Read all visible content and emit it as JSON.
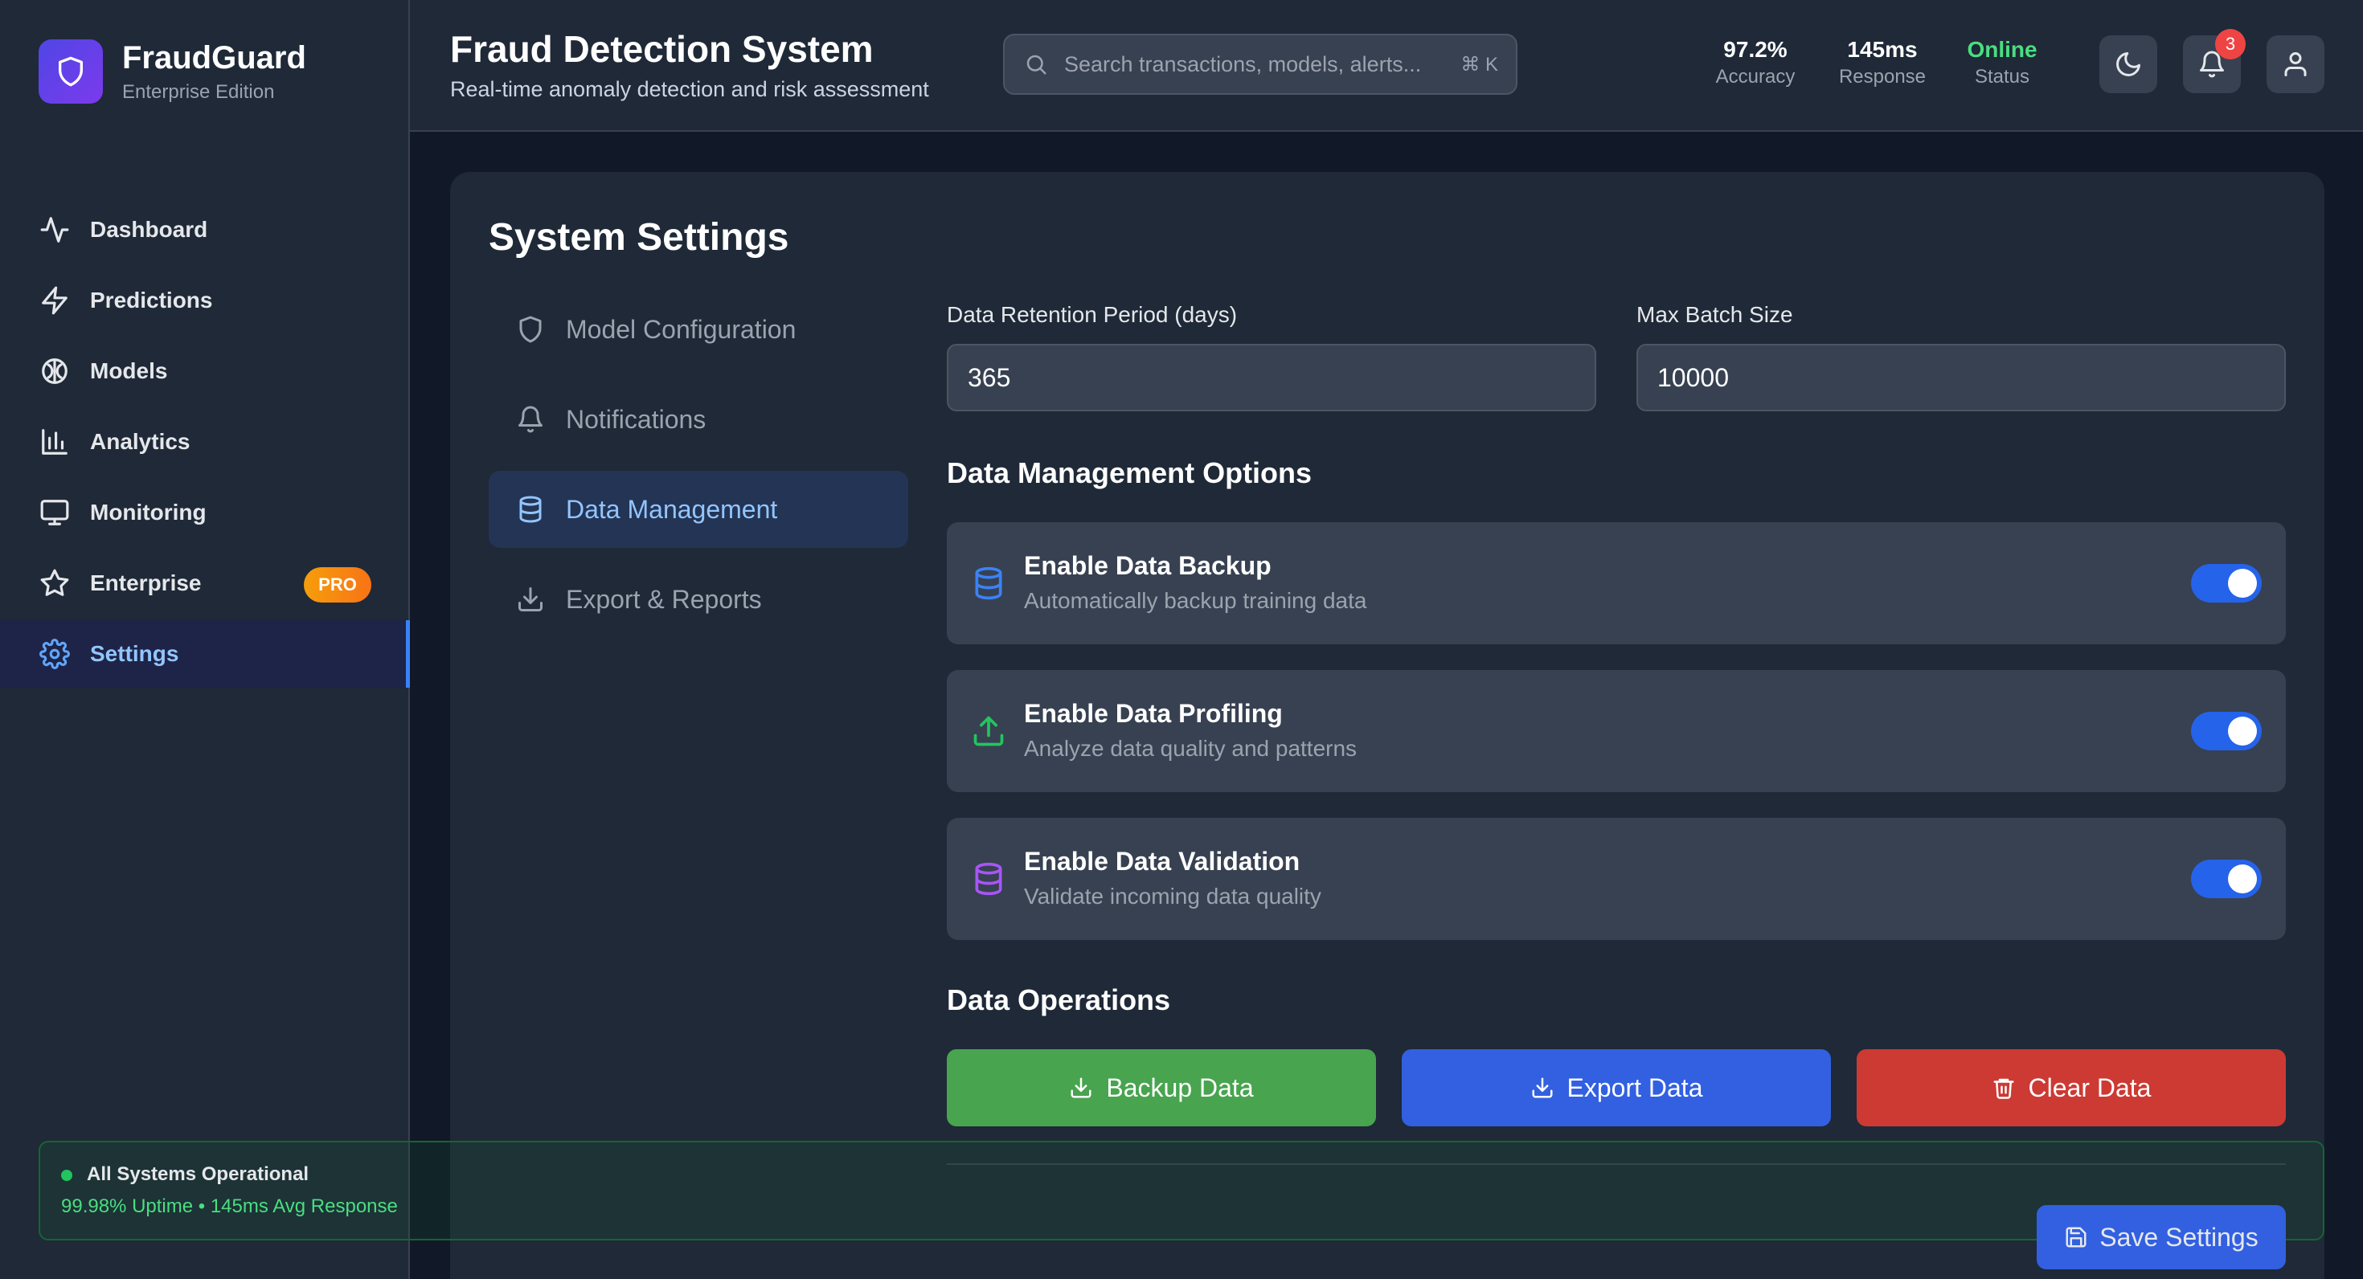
{
  "brand": {
    "name": "FraudGuard",
    "edition": "Enterprise Edition"
  },
  "nav": {
    "items": [
      {
        "label": "Dashboard",
        "icon": "activity-icon"
      },
      {
        "label": "Predictions",
        "icon": "zap-icon"
      },
      {
        "label": "Models",
        "icon": "brain-icon"
      },
      {
        "label": "Analytics",
        "icon": "bar-chart-icon"
      },
      {
        "label": "Monitoring",
        "icon": "monitor-icon"
      },
      {
        "label": "Enterprise",
        "icon": "star-icon",
        "badge": "PRO"
      },
      {
        "label": "Settings",
        "icon": "gear-icon",
        "active": true
      }
    ]
  },
  "header": {
    "title": "Fraud Detection System",
    "subtitle": "Real-time anomaly detection and risk assessment",
    "search_placeholder": "Search transactions, models, alerts...",
    "search_shortcut": "⌘ K",
    "stats": [
      {
        "value": "97.2%",
        "label": "Accuracy"
      },
      {
        "value": "145ms",
        "label": "Response"
      },
      {
        "value": "Online",
        "label": "Status"
      }
    ],
    "notification_count": "3"
  },
  "settings": {
    "title": "System Settings",
    "tabs": [
      {
        "label": "Model Configuration",
        "icon": "shield-icon"
      },
      {
        "label": "Notifications",
        "icon": "bell-icon"
      },
      {
        "label": "Data Management",
        "icon": "database-icon",
        "active": true
      },
      {
        "label": "Export & Reports",
        "icon": "download-icon"
      }
    ],
    "retention_label": "Data Retention Period (days)",
    "retention_value": "365",
    "batch_label": "Max Batch Size",
    "batch_value": "10000",
    "options_title": "Data Management Options",
    "options": [
      {
        "title": "Enable Data Backup",
        "desc": "Automatically backup training data",
        "icon": "database-icon",
        "icon_color": "#3b82f6",
        "enabled": true
      },
      {
        "title": "Enable Data Profiling",
        "desc": "Analyze data quality and patterns",
        "icon": "upload-icon",
        "icon_color": "#22c55e",
        "enabled": true
      },
      {
        "title": "Enable Data Validation",
        "desc": "Validate incoming data quality",
        "icon": "database-icon",
        "icon_color": "#a855f7",
        "enabled": true
      }
    ],
    "operations_title": "Data Operations",
    "operations": [
      {
        "label": "Backup Data",
        "color": "#48a44f"
      },
      {
        "label": "Export Data",
        "color": "#3260e1"
      },
      {
        "label": "Clear Data",
        "color": "#cc3a33"
      }
    ],
    "save_label": "Save Settings"
  },
  "status": {
    "title": "All Systems Operational",
    "detail": "99.98% Uptime • 145ms Avg Response"
  }
}
